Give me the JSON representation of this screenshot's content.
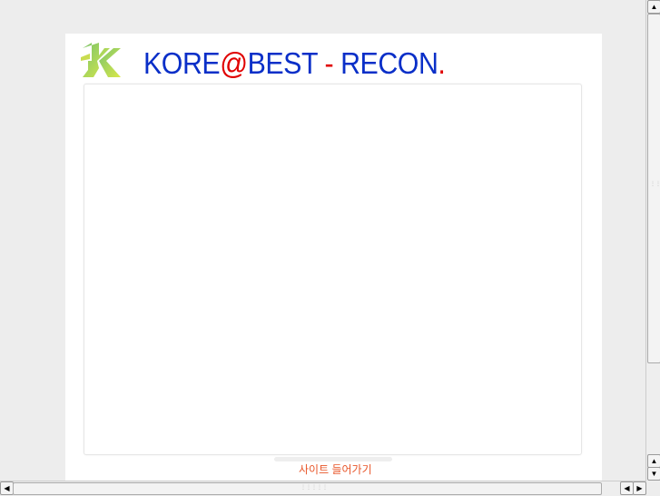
{
  "header": {
    "brand": "KORE",
    "at": "@",
    "brand2": "BEST",
    "dash": " - ",
    "name": "RECON",
    "dot": "."
  },
  "footer": {
    "enter_link": "사이트 들어가기"
  },
  "colors": {
    "brand_blue": "#0a2fc8",
    "accent_red": "#e00000",
    "link_orange": "#e8562a"
  },
  "scrollbars": {
    "up": "▲",
    "down": "▼",
    "left": "◀",
    "right": "▶"
  }
}
